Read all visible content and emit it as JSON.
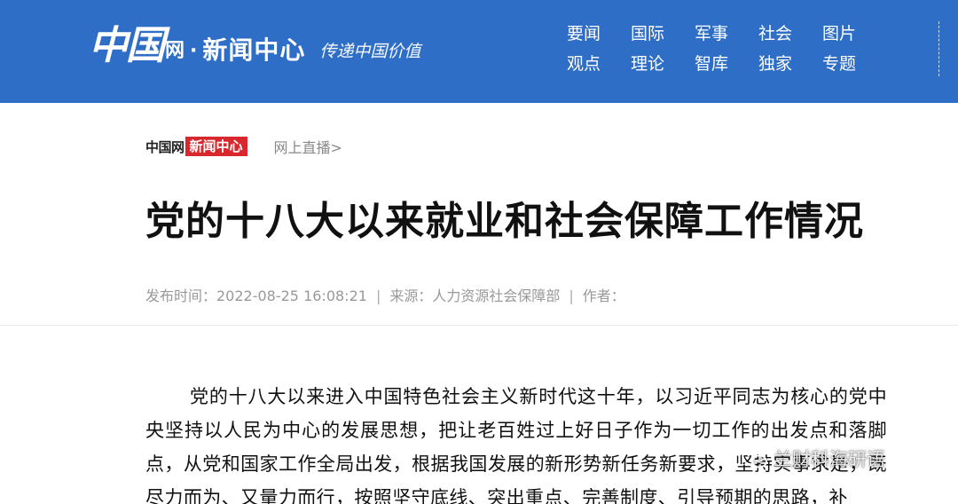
{
  "header": {
    "logo_mark": "中国",
    "logo_wang": "网",
    "logo_dot": "·",
    "logo_center": "新闻中心",
    "slogan": "传递中国价值",
    "nav": [
      "要闻",
      "国际",
      "军事",
      "社会",
      "图片",
      "观点",
      "理论",
      "智库",
      "独家",
      "专题"
    ],
    "bg_color": "#2f6ec6"
  },
  "breadcrumb": {
    "brand": "中国网",
    "badge": "新闻中心",
    "badge_color": "#d8272d",
    "link": "网上直播>"
  },
  "article": {
    "title": "党的十八大以来就业和社会保障工作情况",
    "meta": {
      "published": "发布时间：2022-08-25 16:08:21",
      "separator": "|",
      "source": "来源：人力资源社会保障部",
      "author": "作者："
    },
    "body": "党的十八大以来进入中国特色社会主义新时代这十年，以习近平同志为核心的党中央坚持以人民为中心的发展思想，把让老百姓过上好日子作为一切工作的出发点和落脚点，从党和国家工作全局出发，根据我国发展的新形势新任务新要求，坚持实事求是，既尽力而为、又量力而行，按照坚守底线、突出重点、完善制度、引导预期的思路，补"
  },
  "watermark": {
    "icon": "wechat-icon",
    "text": "兰财科海研语"
  }
}
